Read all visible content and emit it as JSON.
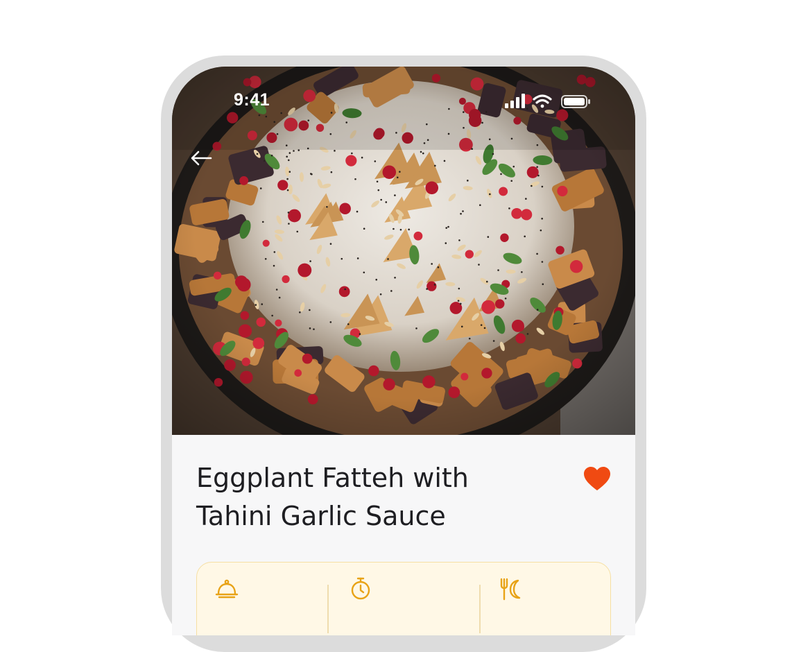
{
  "status_bar": {
    "time": "9:41",
    "icons": [
      "cellular-signal-icon",
      "wifi-icon",
      "battery-icon"
    ]
  },
  "navigation": {
    "back_icon": "arrow-left-icon"
  },
  "recipe": {
    "title_line_1": "Eggplant Fatteh with",
    "title_line_2": "Tahini Garlic Sauce",
    "is_favorite": true,
    "favorite_icon": "heart-icon"
  },
  "info_card": {
    "items": [
      {
        "icon": "serving-cloche-icon"
      },
      {
        "icon": "timer-icon"
      },
      {
        "icon": "fork-moon-icon"
      }
    ]
  },
  "colors": {
    "accent": "#e8a317",
    "favorite": "#f04a12",
    "card_background": "#fff8e6",
    "card_border": "#f6dfa3",
    "text": "#1e1e22"
  }
}
